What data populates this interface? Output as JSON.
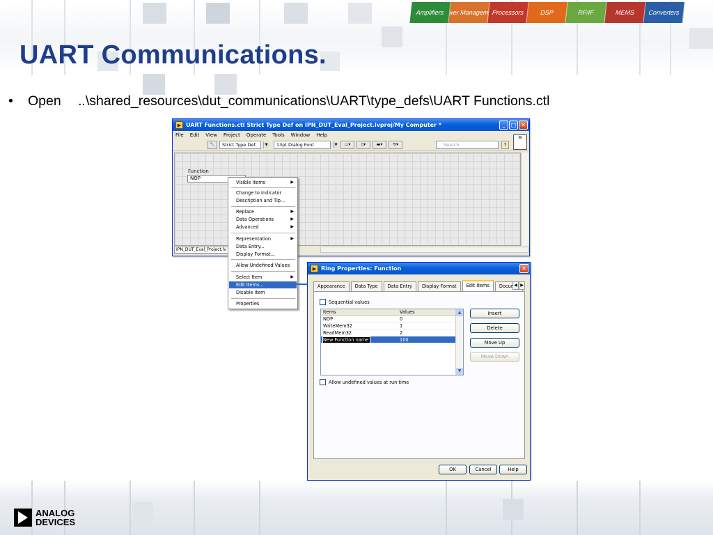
{
  "slide": {
    "title": "UART Communications.",
    "bullet_marker": "•",
    "bullet_verb": "Open",
    "bullet_path": "..\\shared_resources\\dut_communications\\UART\\type_defs\\UART Functions.ctl"
  },
  "banner": {
    "segments": [
      "Amplifiers",
      "Power Management",
      "Processors",
      "DSP",
      "RF/IF",
      "MEMS",
      "Converters"
    ],
    "colors": [
      "#2e8b3a",
      "#d9722a",
      "#c0392b",
      "#e06a1b",
      "#6aa842",
      "#b5362f",
      "#2a5fa8"
    ]
  },
  "logo": {
    "line1": "ANALOG",
    "line2": "DEVICES"
  },
  "main_window": {
    "title": "UART Functions.ctl Strict Type Def on IPN_DUT_Eval_Project.lvproj/My Computer *",
    "menu": [
      "File",
      "Edit",
      "View",
      "Project",
      "Operate",
      "Tools",
      "Window",
      "Help"
    ],
    "typedef_select": "Strict Type Def.",
    "font_select": "13pt Dialog Font",
    "search_placeholder": "Search",
    "help_glyph": "?",
    "control_label": "Function",
    "control_value": "NOP",
    "project_tab": "IPN_DUT_Eval_Project.lv"
  },
  "context_menu": {
    "items": [
      {
        "label": "Visible Items",
        "submenu": true
      },
      {
        "label": "Change to Indicator"
      },
      {
        "label": "Description and Tip..."
      },
      {
        "label": "Replace",
        "submenu": true
      },
      {
        "label": "Data Operations",
        "submenu": true
      },
      {
        "label": "Advanced",
        "submenu": true
      },
      {
        "label": "Representation",
        "submenu": true
      },
      {
        "label": "Data Entry..."
      },
      {
        "label": "Display Format..."
      },
      {
        "label": "Allow Undefined Values"
      },
      {
        "label": "Select Item",
        "submenu": true
      },
      {
        "label": "Edit Items...",
        "selected": true
      },
      {
        "label": "Disable Item"
      },
      {
        "label": "Properties"
      }
    ],
    "submenu_arrow": "▶"
  },
  "ring_dialog": {
    "title": "Ring Properties: Function",
    "tabs": [
      "Appearance",
      "Data Type",
      "Data Entry",
      "Display Format",
      "Edit Items",
      "Documenta"
    ],
    "active_tab": "Edit Items",
    "sequential_label": "Sequential values",
    "table_headers": [
      "Items",
      "Values"
    ],
    "rows": [
      {
        "item": "NOP",
        "value": "0"
      },
      {
        "item": "WriteMem32",
        "value": "1"
      },
      {
        "item": "ReadMem32",
        "value": "2"
      },
      {
        "item": "New Function name",
        "value": "100",
        "selected": true
      }
    ],
    "side_buttons": [
      "Insert",
      "Delete",
      "Move Up",
      "Move Down"
    ],
    "allow_undefined_label": "Allow undefined values at run time",
    "ok": "OK",
    "cancel": "Cancel",
    "help": "Help"
  }
}
